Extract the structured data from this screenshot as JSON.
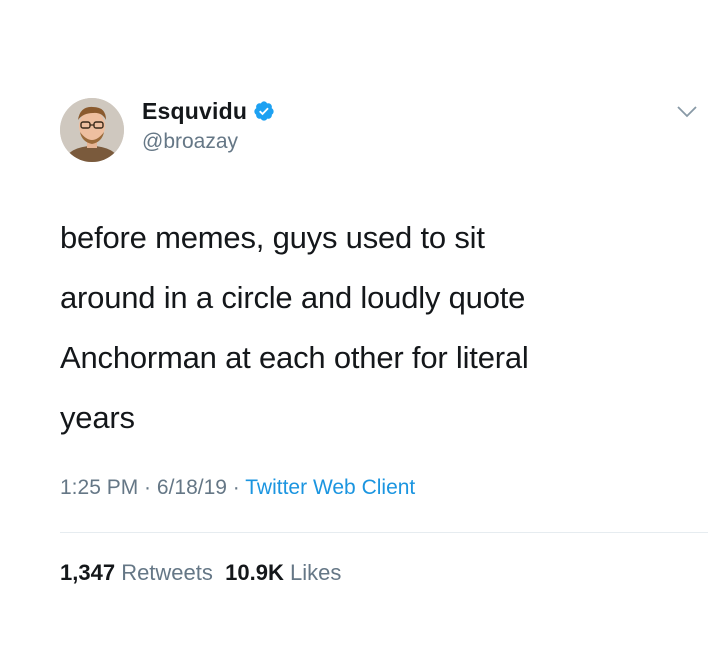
{
  "author": {
    "display_name": "Esquvidu",
    "handle": "@broazay",
    "verified": true,
    "avatar_icon": "profile-photo-icon"
  },
  "tweet": {
    "text_lines": [
      "before memes, guys used to sit",
      "around in a circle and loudly quote",
      "Anchorman at each other for literal",
      "years"
    ]
  },
  "meta": {
    "time": "1:25 PM",
    "sep1": " · ",
    "date": "6/18/19",
    "sep2": " · ",
    "client": "Twitter Web Client"
  },
  "stats": {
    "retweets_count": "1,347",
    "retweets_label": "Retweets",
    "likes_count": "10.9K",
    "likes_label": "Likes"
  },
  "colors": {
    "text": "#14171a",
    "secondary": "#657786",
    "accent": "#1b95e0",
    "divider": "#e6ecf0"
  }
}
